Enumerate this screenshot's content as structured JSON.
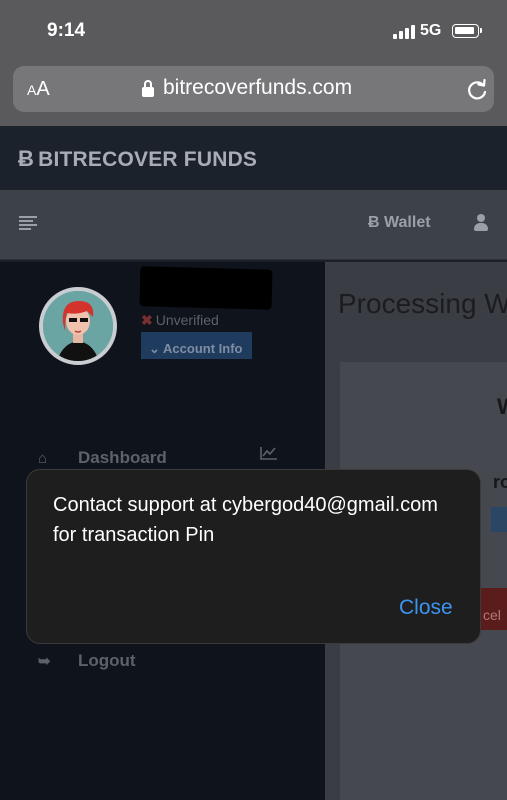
{
  "status_bar": {
    "time": "9:14",
    "network": "5G"
  },
  "browser": {
    "aa_label_small": "A",
    "aa_label_large": "A",
    "url": "bitrecoverfunds.com"
  },
  "site": {
    "brand_symbol": "Ƀ",
    "brand": "BITRECOVER FUNDS",
    "wallet_symbol": "Ƀ",
    "wallet": "Wallet"
  },
  "sidebar": {
    "verification_mark": "✖",
    "verification_status": "Unverified",
    "account_info_arrow": "⌄",
    "account_info": "Account Info",
    "nav": {
      "dashboard_icon": "⌂",
      "dashboard": "Dashboard",
      "logout_icon": "➥",
      "logout": "Logout"
    }
  },
  "main": {
    "page_title": "Processing W",
    "card_heading": "W",
    "card_subheading": "roc",
    "cancel_label": "cel"
  },
  "dialog": {
    "message": "Contact support at cybergod40@gmail.com for transaction Pin",
    "close": "Close"
  },
  "colors": {
    "dialog_bg": "#1e1e1e",
    "dialog_action": "#3c94f0",
    "sidebar_bg": "#0f131b",
    "account_info_bg": "#1f3b5e",
    "cancel_bg": "#5b1d1b"
  }
}
